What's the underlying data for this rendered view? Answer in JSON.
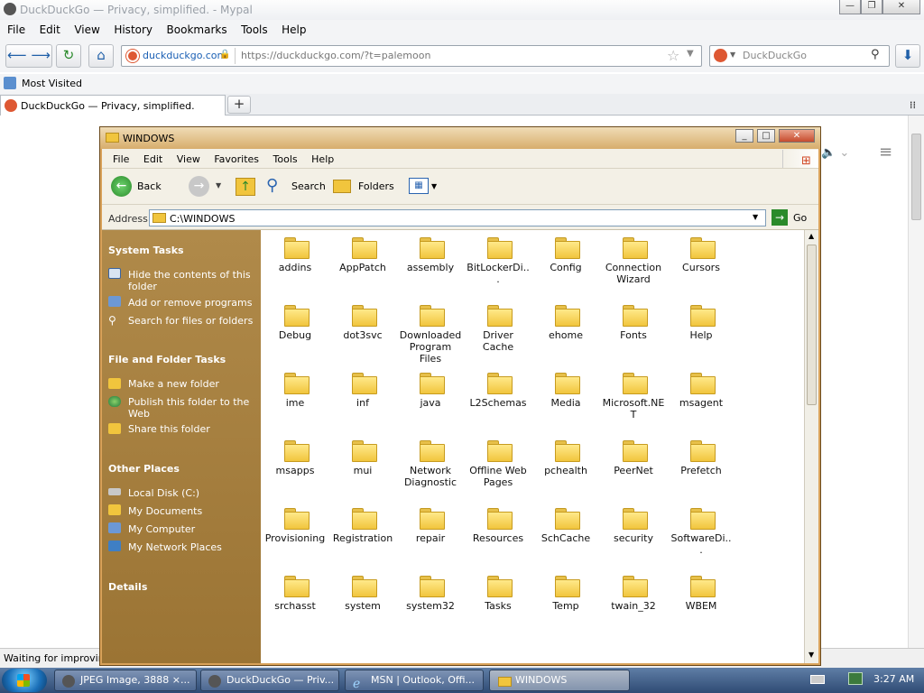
{
  "browser": {
    "title": "DuckDuckGo — Privacy, simplified. - Mypal",
    "menu": [
      "File",
      "Edit",
      "View",
      "History",
      "Bookmarks",
      "Tools",
      "Help"
    ],
    "site_identity": "duckduckgo.com",
    "url": "https://duckduckgo.com/?t=palemoon",
    "search_placeholder": "DuckDuckGo",
    "bookmark": "Most Visited",
    "tab_title": "DuckDuckGo — Privacy, simplified.",
    "new_tab": "+",
    "status": "Waiting for improvin"
  },
  "explorer": {
    "title": "WINDOWS",
    "menu": [
      "File",
      "Edit",
      "View",
      "Favorites",
      "Tools",
      "Help"
    ],
    "toolbar": {
      "back": "Back",
      "search": "Search",
      "folders": "Folders"
    },
    "address_label": "Address",
    "address_value": "C:\\WINDOWS",
    "go": "Go",
    "system_tasks": {
      "title": "System Tasks",
      "items": [
        "Hide the contents of this folder",
        "Add or remove programs",
        "Search for files or folders"
      ]
    },
    "file_tasks": {
      "title": "File and Folder Tasks",
      "items": [
        "Make a new folder",
        "Publish this folder to the Web",
        "Share this folder"
      ]
    },
    "other_places": {
      "title": "Other Places",
      "items": [
        "Local Disk (C:)",
        "My Documents",
        "My Computer",
        "My Network Places"
      ]
    },
    "details_title": "Details",
    "folders": [
      [
        "addins",
        "AppPatch",
        "assembly",
        "BitLockerDi...",
        "Config",
        "Connection Wizard",
        "Cursors"
      ],
      [
        "Debug",
        "dot3svc",
        "Downloaded Program Files",
        "Driver Cache",
        "ehome",
        "Fonts",
        "Help"
      ],
      [
        "ime",
        "inf",
        "java",
        "L2Schemas",
        "Media",
        "Microsoft.NET",
        "msagent"
      ],
      [
        "msapps",
        "mui",
        "Network Diagnostic",
        "Offline Web Pages",
        "pchealth",
        "PeerNet",
        "Prefetch"
      ],
      [
        "Provisioning",
        "Registration",
        "repair",
        "Resources",
        "SchCache",
        "security",
        "SoftwareDi..."
      ],
      [
        "srchasst",
        "system",
        "system32",
        "Tasks",
        "Temp",
        "twain_32",
        "WBEM"
      ]
    ]
  },
  "taskbar": {
    "items": [
      "JPEG Image, 3888 ×...",
      "DuckDuckGo — Priv...",
      "MSN | Outlook, Offi...",
      "WINDOWS"
    ],
    "time": "3:27 AM"
  }
}
